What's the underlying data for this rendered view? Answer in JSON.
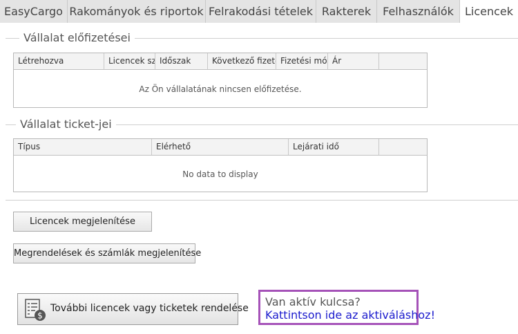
{
  "tabs": [
    {
      "label": "EasyCargo",
      "active": false
    },
    {
      "label": "Rakományok és riportok",
      "active": false
    },
    {
      "label": "Felrakodási tételek",
      "active": false
    },
    {
      "label": "Rakterek",
      "active": false
    },
    {
      "label": "Felhasználók",
      "active": false
    },
    {
      "label": "Licencek",
      "active": true
    }
  ],
  "subscriptions": {
    "title": "Vállalat előfizetései",
    "columns": [
      "Létrehozva",
      "Licencek szá",
      "Időszak",
      "Következő fizetés",
      "Fizetési mód",
      "Ár",
      ""
    ],
    "empty_text": "Az Ön vállalatának nincsen előfizetése."
  },
  "tickets": {
    "title": "Vállalat ticket-jei",
    "columns": [
      "Típus",
      "Elérhető",
      "Lejárati idő",
      ""
    ],
    "empty_text": "No data to display"
  },
  "buttons": {
    "show_licenses": "Licencek megjelenítése",
    "show_orders": "Megrendelések és számlák megjelenítése",
    "order_more": "További licencek vagy ticketek rendelése"
  },
  "activation": {
    "question": "Van aktív kulcsa?",
    "link": "Kattintson ide az aktiváláshoz!"
  },
  "icons": {
    "order_more_icon": "invoice-dollar-icon"
  },
  "colors": {
    "activation_border": "#a552b8",
    "link": "#1a1acd"
  }
}
